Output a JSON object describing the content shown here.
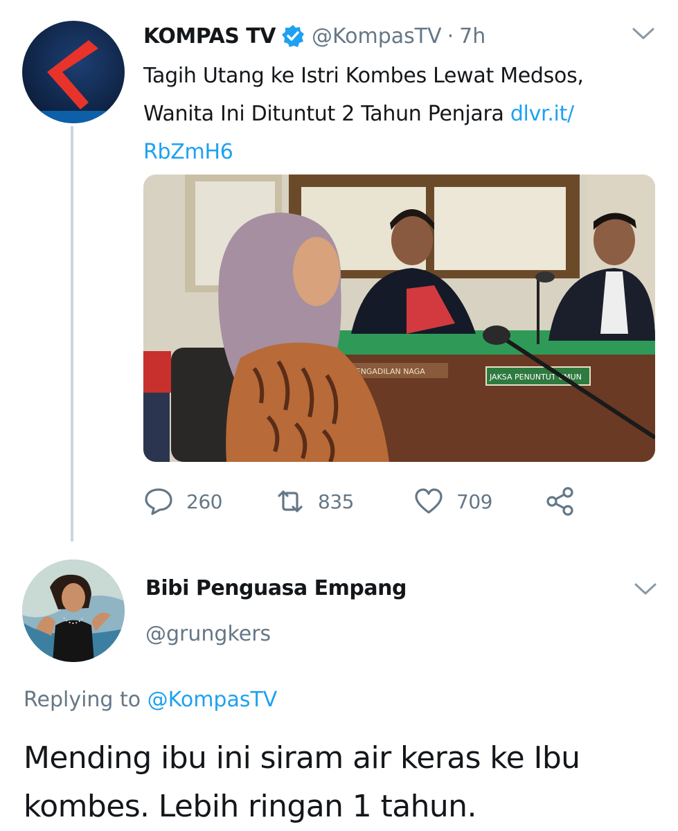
{
  "tweet": {
    "author_name": "KOMPAS TV",
    "author_handle": "@KompasTV",
    "separator": "·",
    "time": "7h",
    "text_line1": "Tagih Utang ke Istri Kombes Lewat Medsos,",
    "text_line2": "Wanita Ini Dituntut 2 Tahun Penjara ",
    "link_part1": "dlvr.it/",
    "link_part2": "RbZmH6",
    "media_signs": {
      "left_desk_sign": "PENGADILAN NAGA",
      "right_desk_sign": "JAKSA PENUNTUT UMUN"
    },
    "reply_count": "260",
    "retweet_count": "835",
    "like_count": "709"
  },
  "reply": {
    "author_name": "Bibi Penguasa Empang",
    "author_handle": "@grungkers",
    "replying_label": "Replying to ",
    "replying_handle": "@KompasTV",
    "text_line1": "Mending ibu ini siram air keras ke Ibu",
    "text_line2": "kombes. Lebih ringan 1 tahun."
  },
  "colors": {
    "accent": "#1da1f2",
    "muted": "#657786",
    "thread_line": "#ccd6dd",
    "verified": "#1da1f2"
  },
  "icons": [
    "verified-badge-icon",
    "chevron-down-icon",
    "reply-icon",
    "retweet-icon",
    "like-icon",
    "share-icon"
  ]
}
